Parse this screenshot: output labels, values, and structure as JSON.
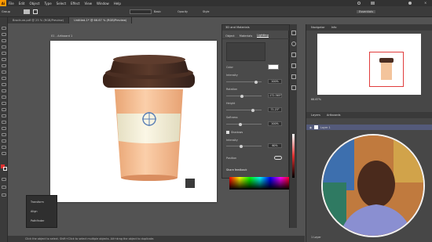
{
  "app": {
    "logo": "Ai",
    "menus": [
      "File",
      "Edit",
      "Object",
      "Type",
      "Select",
      "Effect",
      "View",
      "Window",
      "Help"
    ]
  },
  "control": {
    "group_label": "Group",
    "stroke_style": "Basic",
    "opacity_label": "Opacity",
    "style_label": "Style"
  },
  "tabs": [
    {
      "label": "Brochure.pdf @ 25 % (RGB/Preview)",
      "active": false
    },
    {
      "label": "Untitled-1* @ 66.67 % (RGB/Preview)",
      "active": true
    }
  ],
  "canvas": {
    "artboard_label": "01 - Artboard 1"
  },
  "properties": {
    "title": "3D and Materials",
    "tabs": [
      "Object",
      "Materials",
      "Lighting"
    ],
    "selected_tab": "Lighting",
    "rows": [
      {
        "label": "Color",
        "value": ""
      },
      {
        "label": "Intensity",
        "value": "100%"
      },
      {
        "label": "Rotation",
        "value": "-172.365°"
      },
      {
        "label": "Height",
        "value": "71.23°"
      },
      {
        "label": "Softness",
        "value": "100%"
      }
    ],
    "shadows_label": "Shadows",
    "shadow_intensity": {
      "label": "Intensity",
      "value": "60%"
    },
    "position_label": "Position",
    "presets_label": "Share feedback",
    "knob_levels": {
      "Intensity": 0.88,
      "Rotation": 0.45,
      "Height": 0.78,
      "Softness": 0.38,
      "Shadow": 0.42
    }
  },
  "navigator": {
    "tabs": [
      "Navigator",
      "Info"
    ],
    "zoom": "66.67%"
  },
  "layers": {
    "tabs": [
      "Layers",
      "Artboards"
    ],
    "items": [
      {
        "name": "Layer 1",
        "visible": true
      }
    ],
    "footer": "1 Layer"
  },
  "context": {
    "items": [
      "Transform",
      "Align",
      "Pathfinder"
    ]
  },
  "status": {
    "text": "Click the object to select.   Shift+Click to select multiple objects.   Alt+drag the object to duplicate."
  },
  "colors": {
    "accent": "#ff9a00",
    "app_bg": "#535353",
    "panel_bg": "#4a4a4a"
  }
}
